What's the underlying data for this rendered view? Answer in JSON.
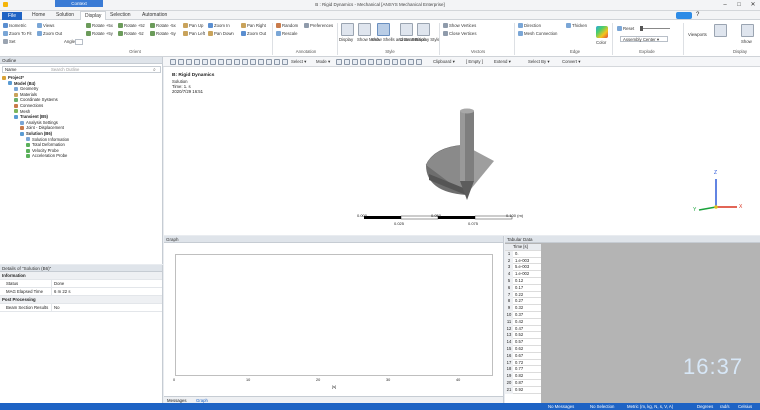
{
  "app": {
    "title": "B : Rigid Dynamics - Mechanical [ANSYS Mechanical Enterprise]",
    "context_tab": "Context"
  },
  "tabs": [
    "File",
    "Home",
    "Solution",
    "Display",
    "Selection",
    "Automation"
  ],
  "ribbon": {
    "orient_row1": [
      "Isometric",
      "Views",
      "Rotate +5x",
      "Rotate +5z",
      "Rotate -5x",
      "Pan Up",
      "Zoom In",
      "Pan Right"
    ],
    "orient_row2": [
      "Zoom To Fit",
      "Zoom Out",
      "Rotate +5y",
      "Rotate -5z",
      "Rotate -5y",
      "Pan Left",
      "Pan Down",
      "Zoom Out"
    ],
    "orient_row3": [
      "Set",
      "Angle"
    ],
    "annotation": [
      "Random",
      "Preferences",
      "Rescale"
    ],
    "style_buttons": [
      "Display",
      "Show Mesh",
      "Show Shells and Beams",
      "Cross Section",
      "Display Style"
    ],
    "vectors": [
      "Show Vertices",
      "Close Vertices"
    ],
    "edge": [
      "Direction",
      "Mesh Connection",
      "Thicken"
    ],
    "color_label": "Color",
    "explode": [
      "Reset",
      "Assembly Center"
    ],
    "viewports": "Viewports",
    "show": "Show",
    "groups": [
      "Orient",
      "Annotation",
      "Style",
      "Vectors",
      "Edge",
      "Explode",
      "Display"
    ]
  },
  "toolbar": {
    "items": [
      "Select",
      "Mode",
      "Clipboard",
      "[ Empty ]",
      "Extend",
      "Select By",
      "Convert"
    ]
  },
  "outline": {
    "title": "Outline",
    "filter_label": "Name",
    "search_placeholder": "Search Outline",
    "tree": [
      {
        "label": "Project*",
        "depth": 0,
        "color": "#d9a235",
        "bold": true
      },
      {
        "label": "Model (B4)",
        "depth": 1,
        "color": "#5a9bd3",
        "bold": true
      },
      {
        "label": "Geometry",
        "depth": 2,
        "color": "#7aa6d6"
      },
      {
        "label": "Materials",
        "depth": 2,
        "color": "#c9a35b"
      },
      {
        "label": "Coordinate Systems",
        "depth": 2,
        "color": "#6aaf6a"
      },
      {
        "label": "Connections",
        "depth": 2,
        "color": "#c97b4b"
      },
      {
        "label": "Mesh",
        "depth": 2,
        "color": "#7cb65c"
      },
      {
        "label": "Transient (B5)",
        "depth": 2,
        "color": "#5a9bd3",
        "bold": true
      },
      {
        "label": "Analysis Settings",
        "depth": 3,
        "color": "#7aa6d6"
      },
      {
        "label": "Joint - Displacement",
        "depth": 3,
        "color": "#c97b4b"
      },
      {
        "label": "Solution (B6)",
        "depth": 3,
        "color": "#5a9bd3",
        "bold": true
      },
      {
        "label": "Solution Information",
        "depth": 4,
        "color": "#7aa6d6"
      },
      {
        "label": "Total Deformation",
        "depth": 4,
        "color": "#5ab05a"
      },
      {
        "label": "Velocity Probe",
        "depth": 4,
        "color": "#5ab05a"
      },
      {
        "label": "Acceleration Probe",
        "depth": 4,
        "color": "#5ab05a"
      }
    ]
  },
  "details": {
    "title": "Details of \"Solution (B6)\"",
    "sections": [
      {
        "name": "Information",
        "rows": [
          [
            "Status",
            "Done"
          ],
          [
            "MAG Elapsed Time",
            "6 m 22 s"
          ]
        ]
      },
      {
        "name": "Post Processing",
        "rows": [
          [
            "Beam Section Results",
            "No"
          ]
        ]
      }
    ]
  },
  "viewport": {
    "title": "B: Rigid Dynamics",
    "sub1": "Solution",
    "sub2": "Time: 1. s",
    "sub3": "2020/7/29 16:51",
    "scale_top": [
      "0.000",
      "0.050",
      "0.100 (m)"
    ],
    "scale_bottom": [
      "0.025",
      "0.075"
    ],
    "axes": {
      "x": "X",
      "y": "Y",
      "z": "Z"
    }
  },
  "graph": {
    "title": "Graph",
    "x_ticks": [
      "0",
      "10",
      "20",
      "30",
      "40"
    ],
    "x_label": "[s]",
    "bottom_tabs": [
      "Messages",
      "Graph"
    ]
  },
  "tabular": {
    "title": "Tabular Data",
    "col_header": "Time [s]",
    "rows": [
      [
        "1",
        "0."
      ],
      [
        "2",
        "1.e-003"
      ],
      [
        "3",
        "5.e-003"
      ],
      [
        "4",
        "1.e-002"
      ],
      [
        "5",
        "0.12"
      ],
      [
        "6",
        "0.17"
      ],
      [
        "7",
        "0.22"
      ],
      [
        "8",
        "0.27"
      ],
      [
        "9",
        "0.32"
      ],
      [
        "10",
        "0.37"
      ],
      [
        "11",
        "0.42"
      ],
      [
        "12",
        "0.47"
      ],
      [
        "13",
        "0.52"
      ],
      [
        "14",
        "0.57"
      ],
      [
        "15",
        "0.62"
      ],
      [
        "16",
        "0.67"
      ],
      [
        "17",
        "0.72"
      ],
      [
        "18",
        "0.77"
      ],
      [
        "19",
        "0.82"
      ],
      [
        "20",
        "0.87"
      ],
      [
        "21",
        "0.92"
      ]
    ]
  },
  "clock": {
    "time": "16:37"
  },
  "status": {
    "items": [
      "No Messages",
      "No Selection",
      "Metric (m, kg, N, s, V, A)",
      "Degrees",
      "rad/s",
      "Celsius"
    ]
  },
  "colors": {
    "accent": "#1e63c4",
    "model": "#7d7d7d"
  }
}
